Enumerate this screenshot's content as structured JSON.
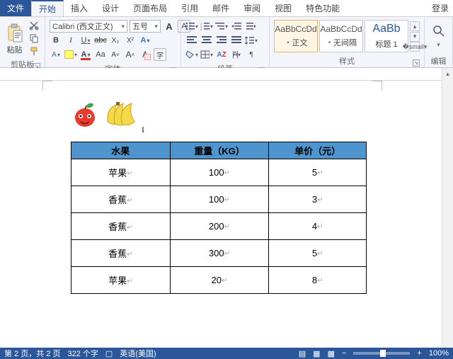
{
  "tabs": {
    "file": "文件",
    "items": [
      "开始",
      "插入",
      "设计",
      "页面布局",
      "引用",
      "邮件",
      "审阅",
      "视图",
      "特色功能"
    ],
    "active_index": 0,
    "login": "登录"
  },
  "ribbon": {
    "clipboard": {
      "paste": "粘贴",
      "group_label": "剪贴板"
    },
    "font": {
      "font_name": "Calibri (西文正文)",
      "font_size": "五号",
      "group_label": "字体",
      "buttons": {
        "bold": "B",
        "italic": "I",
        "underline": "U",
        "strike": "abc",
        "sub": "X₂",
        "sup": "X²",
        "case": "Aa",
        "clear": "A",
        "grow": "A",
        "shrink": "A"
      }
    },
    "paragraph": {
      "group_label": "段落"
    },
    "styles": {
      "group_label": "样式",
      "sample": "AaBbCcDd",
      "sample_big": "AaBb",
      "tiles": [
        "﹡正文",
        "﹡无间隔",
        "标题 1"
      ]
    },
    "edit": {
      "group_label": "编辑"
    }
  },
  "document": {
    "columns": [
      "水果",
      "重量（KG）",
      "单价（元）"
    ],
    "rows": [
      {
        "name": "苹果",
        "weight": "100",
        "price": "5"
      },
      {
        "name": "香蕉",
        "weight": "100",
        "price": "3"
      },
      {
        "name": "香蕉",
        "weight": "200",
        "price": "4"
      },
      {
        "name": "香蕉",
        "weight": "300",
        "price": "5"
      },
      {
        "name": "苹果",
        "weight": "20",
        "price": "8"
      }
    ]
  },
  "status": {
    "page": "第 2 页，共 2 页",
    "words": "322 个字",
    "lang_icon": "▢",
    "lang": "英语(美国)",
    "zoom_minus": "−",
    "zoom_plus": "+",
    "zoom": "100%"
  }
}
